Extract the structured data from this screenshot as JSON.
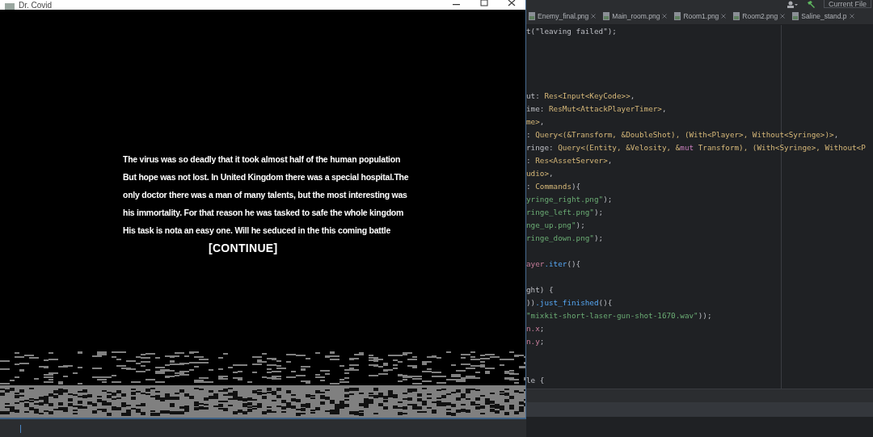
{
  "ide": {
    "run_config": "Current File",
    "tabs": [
      {
        "label": "Enemy_final.png",
        "selected": false
      },
      {
        "label": "Main_room.png",
        "selected": false
      },
      {
        "label": "Room1.png",
        "selected": false
      },
      {
        "label": "Room2.png",
        "selected": false
      },
      {
        "label": "Saline_stand.p",
        "selected": false
      }
    ],
    "code_lines": [
      {
        "kind": "code",
        "tokens": [
          {
            "kind": "plain",
            "text": "t(\"leaving failed\");"
          }
        ]
      },
      {
        "kind": "blank"
      },
      {
        "kind": "blank"
      },
      {
        "kind": "blank"
      },
      {
        "kind": "blank"
      },
      {
        "kind": "code",
        "tokens": [
          {
            "kind": "plain",
            "text": "ut: "
          },
          {
            "kind": "type",
            "text": "Res<Input<KeyCode>>"
          },
          {
            "kind": "plain",
            "text": ","
          }
        ]
      },
      {
        "kind": "code",
        "tokens": [
          {
            "kind": "plain",
            "text": "ime: "
          },
          {
            "kind": "type",
            "text": "ResMut<AttackPlayerTimer>"
          },
          {
            "kind": "plain",
            "text": ","
          }
        ]
      },
      {
        "kind": "code",
        "tokens": [
          {
            "kind": "type",
            "text": "me>"
          },
          {
            "kind": "plain",
            "text": ","
          }
        ]
      },
      {
        "kind": "code",
        "tokens": [
          {
            "kind": "plain",
            "text": ": "
          },
          {
            "kind": "type",
            "text": "Query<(&Transform, &DoubleShot), (With<Player>, Without<Syringe>)>"
          },
          {
            "kind": "plain",
            "text": ","
          }
        ]
      },
      {
        "kind": "code",
        "tokens": [
          {
            "kind": "plain",
            "text": "ringe: "
          },
          {
            "kind": "type",
            "text": "Query<(Entity, &Velosity, &"
          },
          {
            "kind": "keyword",
            "text": "mut"
          },
          {
            "kind": "type",
            "text": " Transform), (With<Syringe>, Without<P"
          }
        ]
      },
      {
        "kind": "code",
        "tokens": [
          {
            "kind": "plain",
            "text": ": "
          },
          {
            "kind": "type",
            "text": "Res<AssetServer>"
          },
          {
            "kind": "plain",
            "text": ","
          }
        ]
      },
      {
        "kind": "code",
        "tokens": [
          {
            "kind": "type",
            "text": "udio>"
          },
          {
            "kind": "plain",
            "text": ","
          }
        ]
      },
      {
        "kind": "code",
        "tokens": [
          {
            "kind": "plain",
            "text": ": "
          },
          {
            "kind": "type",
            "text": "Commands"
          },
          {
            "kind": "plain",
            "text": "){"
          }
        ]
      },
      {
        "kind": "code",
        "tokens": [
          {
            "kind": "string",
            "text": "yringe_right.png\""
          },
          {
            "kind": "plain",
            "text": ");"
          }
        ]
      },
      {
        "kind": "code",
        "tokens": [
          {
            "kind": "string",
            "text": "ringe_left.png\""
          },
          {
            "kind": "plain",
            "text": ");"
          }
        ]
      },
      {
        "kind": "code",
        "tokens": [
          {
            "kind": "string",
            "text": "nge_up.png\""
          },
          {
            "kind": "plain",
            "text": ");"
          }
        ]
      },
      {
        "kind": "code",
        "tokens": [
          {
            "kind": "string",
            "text": "ringe_down.png\""
          },
          {
            "kind": "plain",
            "text": ");"
          }
        ]
      },
      {
        "kind": "blank"
      },
      {
        "kind": "code",
        "tokens": [
          {
            "kind": "field",
            "text": "ayer"
          },
          {
            "kind": "method",
            "text": ".iter"
          },
          {
            "kind": "plain",
            "text": "(){"
          }
        ]
      },
      {
        "kind": "blank"
      },
      {
        "kind": "code",
        "tokens": [
          {
            "kind": "plain",
            "text": "ght) {"
          }
        ]
      },
      {
        "kind": "code",
        "tokens": [
          {
            "kind": "plain",
            "text": "))"
          },
          {
            "kind": "method",
            "text": ".just_finished"
          },
          {
            "kind": "plain",
            "text": "(){"
          }
        ]
      },
      {
        "kind": "code",
        "tokens": [
          {
            "kind": "string",
            "text": "\"mixkit-short-laser-gun-shot-1670.wav\""
          },
          {
            "kind": "plain",
            "text": "));"
          }
        ]
      },
      {
        "kind": "code",
        "tokens": [
          {
            "kind": "field",
            "text": "n.x"
          },
          {
            "kind": "plain",
            "text": ";"
          }
        ]
      },
      {
        "kind": "code",
        "tokens": [
          {
            "kind": "field",
            "text": "n.y"
          },
          {
            "kind": "plain",
            "text": ";"
          }
        ]
      },
      {
        "kind": "blank"
      },
      {
        "kind": "blank"
      },
      {
        "kind": "code",
        "tokens": [
          {
            "kind": "plain",
            "text": "le {"
          }
        ]
      }
    ]
  },
  "game_window": {
    "title": "Dr. Covid",
    "story_lines": [
      "The virus was so deadly that it took almost half of the human population",
      "But hope was not lost. In United Kingdom there was a special hospital.The",
      "only doctor there was a man of many talents, but the most interesting was",
      "his immortality. For that reason he was tasked to safe the whole kingdom",
      "His task is nota an easy one. Will he seduced in the this coming battle"
    ],
    "continue_label": "[CONTINUE]"
  }
}
